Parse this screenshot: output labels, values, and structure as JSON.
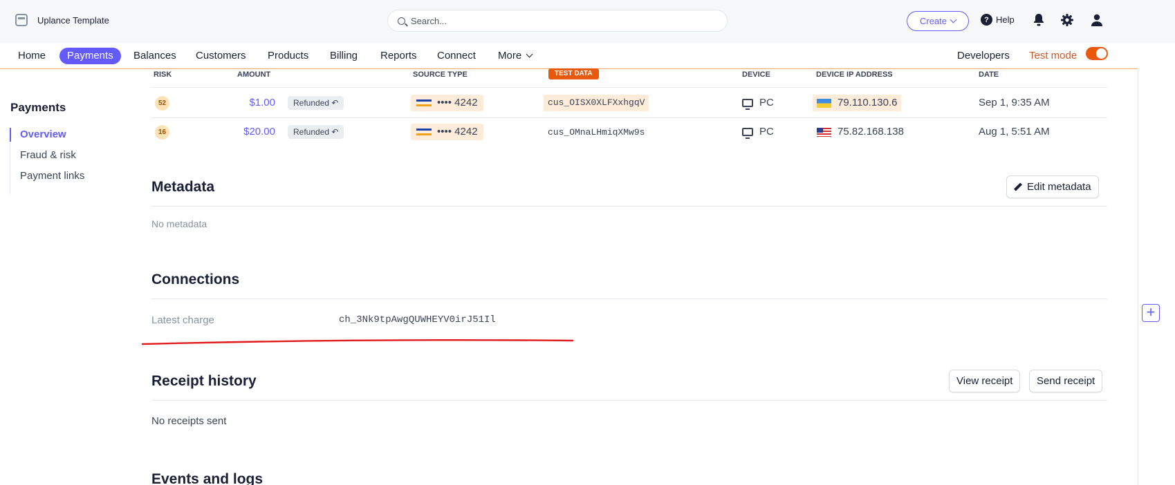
{
  "topbar": {
    "app_name": "Uplance Template",
    "search_placeholder": "Search...",
    "create_label": "Create",
    "help_label": "Help",
    "icons": [
      "bell-icon",
      "gear-icon",
      "user-icon"
    ]
  },
  "nav": {
    "items": [
      "Home",
      "Payments",
      "Balances",
      "Customers",
      "Products",
      "Billing",
      "Reports",
      "Connect",
      "More"
    ],
    "active": "Payments",
    "developers": "Developers",
    "test_mode": "Test mode"
  },
  "sidebar": {
    "title": "Payments",
    "items": [
      "Overview",
      "Fraud & risk",
      "Payment links"
    ],
    "active": "Overview"
  },
  "table": {
    "headers": {
      "risk": "RISK",
      "amount": "AMOUNT",
      "source_type": "SOURCE TYPE",
      "test_data": "TEST DATA",
      "device": "DEVICE",
      "device_ip": "DEVICE IP ADDRESS",
      "date": "DATE"
    },
    "rows": [
      {
        "risk": "52",
        "amount": "$1.00",
        "status": "Refunded ↶",
        "card": "•••• 4242",
        "customer": "cus_OISX0XLFXxhgqV",
        "device": "PC",
        "ip": "79.110.130.6",
        "flag": "ua",
        "date": "Sep 1, 9:35 AM"
      },
      {
        "risk": "16",
        "amount": "$20.00",
        "status": "Refunded ↶",
        "card": "•••• 4242",
        "customer": "cus_OMnaLHmiqXMw9s",
        "device": "PC",
        "ip": "75.82.168.138",
        "flag": "us",
        "date": "Aug 1, 5:51 AM"
      }
    ]
  },
  "metadata": {
    "title": "Metadata",
    "edit_label": "Edit metadata",
    "empty": "No metadata"
  },
  "connections": {
    "title": "Connections",
    "label": "Latest charge",
    "value": "ch_3Nk9tpAwgQUWHEYV0irJ51Il"
  },
  "receipts": {
    "title": "Receipt history",
    "view_label": "View receipt",
    "send_label": "Send receipt",
    "empty": "No receipts sent"
  },
  "events": {
    "title": "Events and logs"
  },
  "colors": {
    "accent": "#635bff",
    "test_mode": "#e8590c",
    "annotation_red": "#e01a1a"
  }
}
